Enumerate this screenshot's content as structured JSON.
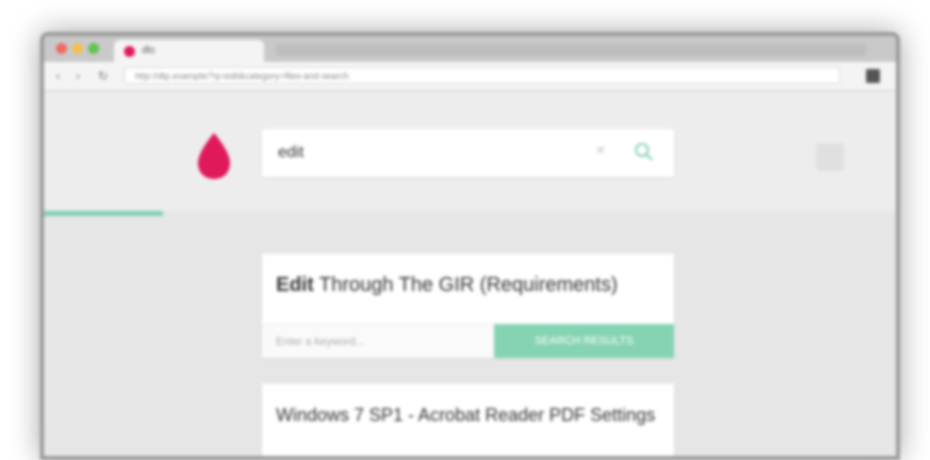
{
  "browser": {
    "tab_title": "dtc",
    "url": "http://dtp.example/?q=edit&category=files-and-search",
    "nav": {
      "back": "‹",
      "forward": "›",
      "reload": "↻"
    }
  },
  "search": {
    "query": "edit",
    "clear_symbol": "×"
  },
  "colors": {
    "brand": "#e0195a",
    "accent": "#7fd1b2",
    "cta": "#86d3b4"
  },
  "progress": {
    "percent": 14
  },
  "results": [
    {
      "title_bold": "Edit",
      "title_rest": " Through The GIR (Requirements)",
      "input_placeholder": "Enter a keyword...",
      "cta_label": "SEARCH RESULTS"
    },
    {
      "title": "Windows 7 SP1 - Acrobat Reader PDF Settings"
    }
  ]
}
